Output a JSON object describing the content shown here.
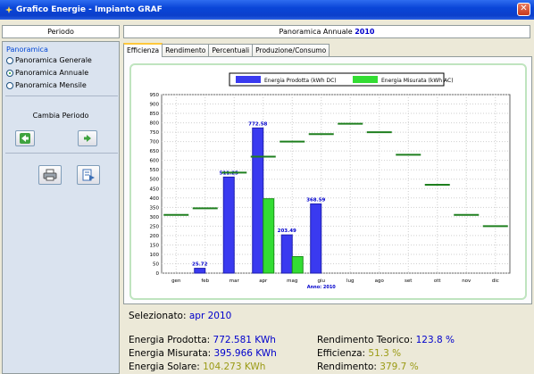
{
  "window": {
    "title": "Grafico Energie - Impianto GRAF",
    "close_icon": "close-icon"
  },
  "left": {
    "header": "Periodo",
    "group_label": "Panoramica",
    "options": [
      {
        "label": "Panoramica Generale",
        "selected": false
      },
      {
        "label": "Panoramica Annuale",
        "selected": true
      },
      {
        "label": "Panoramica Mensile",
        "selected": false
      }
    ],
    "change_period_label": "Cambia Periodo",
    "prev_icon": "arrow-left-icon",
    "next_icon": "arrow-right-icon",
    "print_icon": "printer-icon",
    "export_icon": "export-icon"
  },
  "right": {
    "header_prefix": "Panoramica Annuale",
    "header_year": "2010",
    "tabs": [
      "Efficienza",
      "Rendimento",
      "Percentuali",
      "Produzione/Consumo"
    ],
    "active_tab": 0
  },
  "colors": {
    "produced": "#3a3af0",
    "measured": "#33dd33",
    "solar": "#1e7f1e"
  },
  "chart_data": {
    "type": "bar",
    "categories": [
      "gen",
      "feb",
      "mar",
      "apr",
      "mag",
      "giu",
      "lug",
      "ago",
      "set",
      "ott",
      "nov",
      "dic"
    ],
    "series": [
      {
        "name": "Energia Prodotta (kWh DC)",
        "values": [
          0,
          25.72,
          511.25,
          772.58,
          203.49,
          368.59,
          0,
          0,
          0,
          0,
          0,
          0
        ]
      },
      {
        "name": "Energia Misurata (kWh AC)",
        "values": [
          0,
          0,
          0,
          396,
          88,
          0,
          0,
          0,
          0,
          0,
          0,
          0
        ]
      }
    ],
    "reference_levels": [
      310,
      345,
      535,
      620,
      700,
      740,
      795,
      750,
      630,
      470,
      310,
      250
    ],
    "data_labels": [
      "",
      "25.72",
      "511.25",
      "772.58",
      "203.49",
      "368.59",
      "",
      "",
      "",
      "",
      "",
      ""
    ],
    "xlabel": "Anno: 2010",
    "ylim": [
      0,
      950
    ],
    "yticks": [
      0,
      50,
      100,
      150,
      200,
      250,
      300,
      350,
      400,
      450,
      500,
      550,
      600,
      650,
      700,
      750,
      800,
      850,
      900,
      950
    ],
    "grid": true,
    "legend_placement": "top-center"
  },
  "summary": {
    "selected_label": "Selezionato:",
    "selected_value": "apr 2010",
    "produced_label": "Energia Prodotta:",
    "produced_value": "772.581 KWh",
    "measured_label": "Energia Misurata:",
    "measured_value": "395.966 KWh",
    "solar_label": "Energia Solare:",
    "solar_value": "104.273 KWh",
    "theoretical_label": "Rendimento Teorico:",
    "theoretical_value": "123.8 %",
    "efficiency_label": "Efficienza:",
    "efficiency_value": "51.3 %",
    "yield_label": "Rendimento:",
    "yield_value": "379.7 %"
  }
}
